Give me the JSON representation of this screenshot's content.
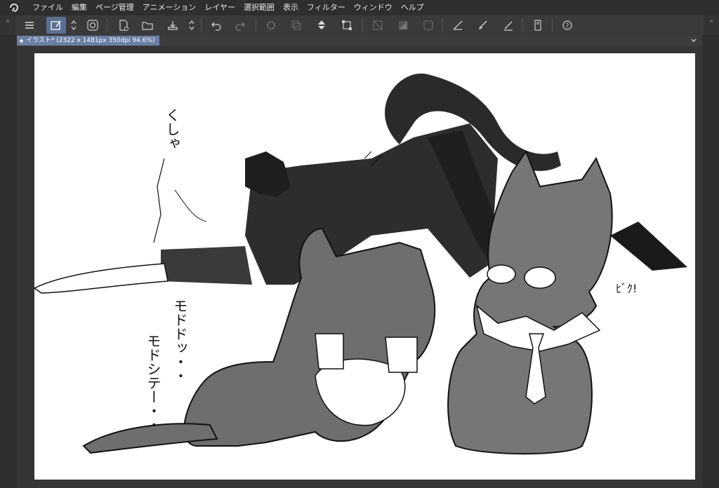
{
  "menubar": {
    "logo_icon": "clip-studio-logo-icon",
    "items": [
      {
        "label": "ファイル"
      },
      {
        "label": "編集"
      },
      {
        "label": "ページ管理"
      },
      {
        "label": "アニメーション"
      },
      {
        "label": "レイヤー"
      },
      {
        "label": "選択範囲"
      },
      {
        "label": "表示"
      },
      {
        "label": "フィルター"
      },
      {
        "label": "ウィンドウ"
      },
      {
        "label": "ヘルプ"
      }
    ]
  },
  "toolbar": {
    "buttons": [
      "menu-icon",
      "canvas-edit-icon",
      "scroll-arrows-icon",
      "spiral-icon",
      "new-file-icon",
      "open-folder-icon",
      "save-icon",
      "save-arrows-icon",
      "undo-icon",
      "redo-icon",
      "loading-icon",
      "copy-layer-icon",
      "fill-icon",
      "transform-icon",
      "deselect-icon",
      "gradient-icon",
      "invert-icon",
      "line-tool-icon",
      "brush-icon",
      "pen-icon",
      "tablet-icon",
      "help-icon"
    ]
  },
  "document": {
    "tab_label": "イラスト* (2322 x 1481px 350dpi 94.6%)"
  },
  "canvas": {
    "sfx": [
      "くしゃ",
      "モドドッ・・",
      "モドシテー・・",
      "ﾋﾞｸ!"
    ]
  },
  "colors": {
    "active_button": "#5b6f93",
    "tab": "#6b7fa3",
    "background": "#3c3c3c"
  }
}
